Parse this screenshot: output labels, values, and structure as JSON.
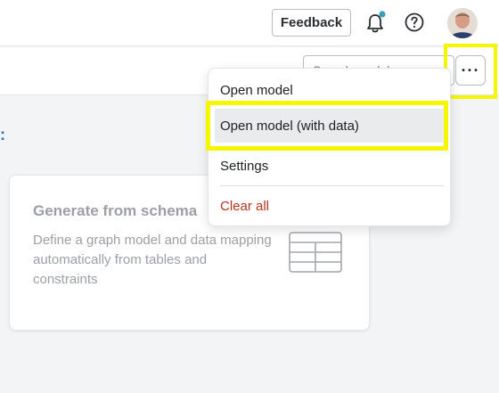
{
  "header": {
    "feedback_label": "Feedback",
    "notification_badge_color": "#3aa0b8",
    "icons": [
      "bell-icon",
      "help-icon",
      "avatar"
    ]
  },
  "toolbar": {
    "search_placeholder": "Search model...",
    "more_label": "···"
  },
  "card": {
    "title": "Generate from schema",
    "description": "Define a graph model and data mapping automatically from tables and constraints",
    "icon": "table-icon"
  },
  "menu": {
    "items": [
      {
        "label": "Open model"
      },
      {
        "label": "Open model (with data)"
      },
      {
        "label": "Settings"
      },
      {
        "label": "Clear all"
      }
    ]
  },
  "colors": {
    "highlight": "#f6f600",
    "danger": "#b5341c",
    "accent": "#2d6fb0"
  }
}
